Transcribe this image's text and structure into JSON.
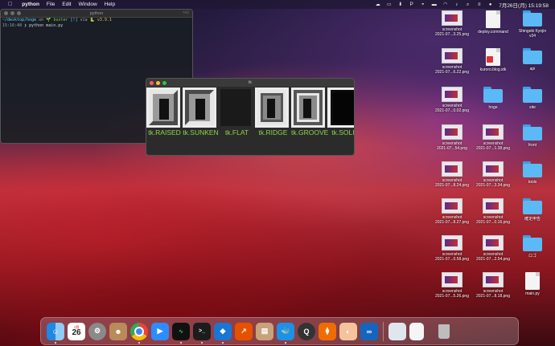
{
  "menubar": {
    "app": "python",
    "menus": [
      "File",
      "Edit",
      "Window",
      "Help"
    ],
    "datetime": "7月26日(月) 15:19:58"
  },
  "terminal": {
    "title": "python",
    "shortcut": "⌥⌘2",
    "line1_dir": "~/desktop/hoge",
    "line1_on": "on",
    "line1_branch": "🌱 buster",
    "line1_count": "[!]",
    "line1_via": "via",
    "line1_version": "🐍 v3.9.1",
    "line2_time": "15:16:48",
    "line2_cmd": "❯ python main.py"
  },
  "tk_window": {
    "title": "tk",
    "labels": [
      "tk.RAISED",
      "tk.SUNKEN",
      "tk.FLAT",
      "tk.RIDGE",
      "tk.GROOVE",
      "tk.SOLID"
    ]
  },
  "desktop": {
    "col1": [
      "screenshot\n2021-07...3.25.png",
      "screenshot\n2021-07...6.22.png",
      "screenshot\n2021-07...0.02.png",
      "screenshot\n2021-07...54.png",
      "screenshot\n2021-07...8.24.png",
      "screenshot\n2021-07...8.27.png",
      "screenshot\n2021-07...0.58.png",
      "screenshot\n2021-07...5.26.png"
    ],
    "col2": [
      "deploy.command",
      "kuroro.blog.stk",
      "hoge",
      "screenshot\n2021-07...1.38.png",
      "screenshot\n2021-07...3.34.png",
      "screenshot\n2021-07...0.16.png",
      "screenshot\n2021-07...2.54.png",
      "screenshot\n2021-07...8.18.png"
    ],
    "col3": [
      "Shingeki Kyojin\nv34",
      "api",
      "site",
      "front",
      "tools",
      "確定申告",
      "ロゴ",
      "main.py"
    ]
  },
  "dock": {
    "apps": [
      "finder-icon",
      "calendar-icon",
      "system-preferences-icon",
      "contacts-icon",
      "chrome-icon",
      "zoom-icon",
      "activity-monitor-icon",
      "terminal-icon",
      "vscode-icon",
      "grapher-icon",
      "archive-icon",
      "docker-icon",
      "quicktime-icon",
      "sourcetree-icon",
      "sequel-icon",
      "infinity-icon"
    ],
    "calendar_month": "7月",
    "calendar_day": "26",
    "trash": "trash-icon"
  }
}
